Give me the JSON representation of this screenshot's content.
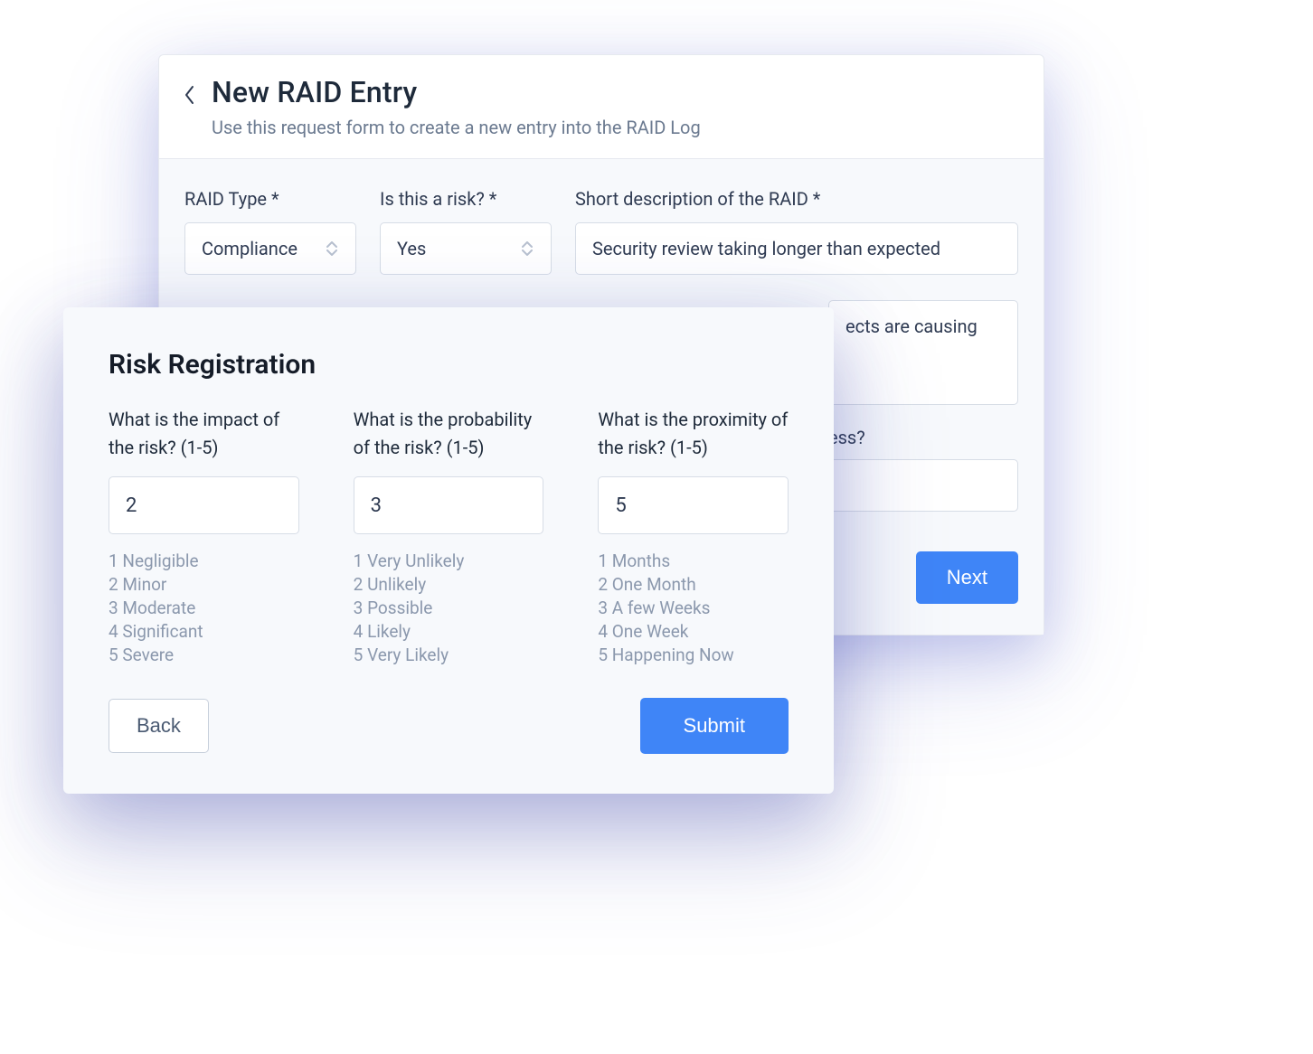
{
  "back_card": {
    "title": "New RAID Entry",
    "subtitle": "Use this request form to create a new entry into the RAID Log",
    "fields": {
      "raid_type": {
        "label": "RAID Type *",
        "value": "Compliance"
      },
      "is_risk": {
        "label": "Is this a risk? *",
        "value": "Yes"
      },
      "short_desc": {
        "label": "Short description of the RAID *",
        "value": "Security review taking longer than expected"
      }
    },
    "peek_text_1": "ects are causing",
    "peek_text_2": "ess?",
    "next_label": "Next"
  },
  "front_card": {
    "title": "Risk Registration",
    "columns": [
      {
        "label": "What is the impact of the risk? (1-5)",
        "value": "2",
        "legend": [
          "1 Negligible",
          "2 Minor",
          "3 Moderate",
          "4 Significant",
          "5 Severe"
        ]
      },
      {
        "label": "What is the probability of the risk? (1-5)",
        "value": "3",
        "legend": [
          "1 Very Unlikely",
          "2 Unlikely",
          "3 Possible",
          "4 Likely",
          "5 Very Likely"
        ]
      },
      {
        "label": "What is the proximity of the risk? (1-5)",
        "value": "5",
        "legend": [
          "1 Months",
          "2 One Month",
          "3 A few Weeks",
          "4 One Week",
          "5 Happening Now"
        ]
      }
    ],
    "back_label": "Back",
    "submit_label": "Submit"
  }
}
